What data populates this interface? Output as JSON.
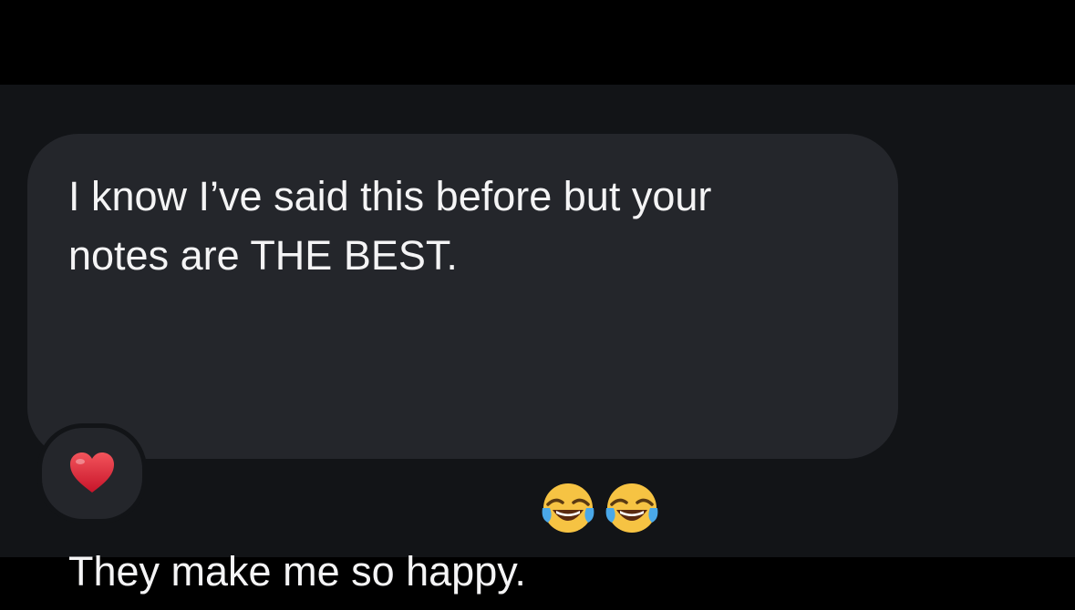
{
  "message": {
    "line1": "I know I’ve said this before but your",
    "line2": "notes are THE BEST.",
    "line3": "They make me so happy.",
    "emoji": [
      "face-with-tears-of-joy-icon",
      "face-with-tears-of-joy-icon"
    ]
  },
  "reaction": {
    "emoji": "heart-icon"
  },
  "colors": {
    "background": "#121417",
    "bubble": "#24262b",
    "text": "#f4f4f5",
    "heart": "#e0263a"
  }
}
